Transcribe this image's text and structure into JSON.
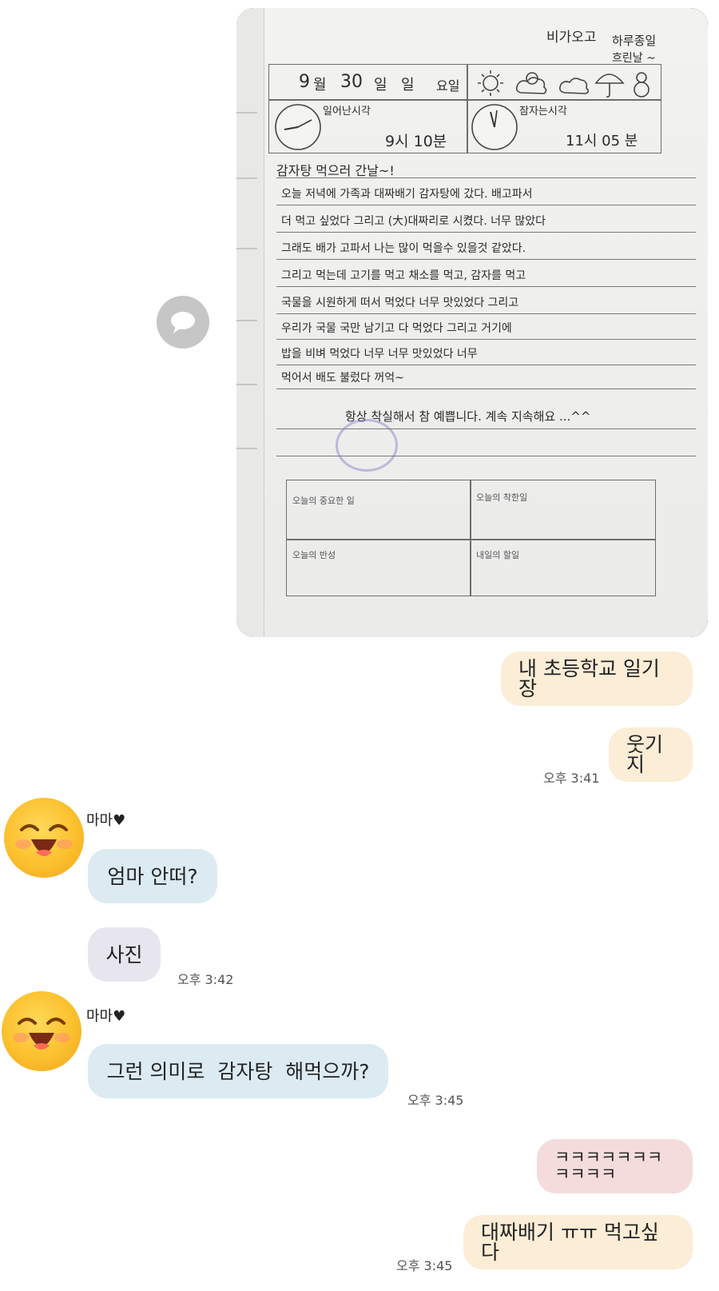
{
  "photo": {
    "top_scribble_left": "비가오고",
    "top_scribble_right": "하루종일",
    "top_scribble_right2": "흐린날 ~",
    "date": {
      "month": "9",
      "month_unit": "월",
      "day": "30",
      "day_unit": "일",
      "day2": "일",
      "weekday_unit": "요일"
    },
    "wakeup_label": "일어난시각",
    "wakeup_time": "9시 10분",
    "sleep_label": "잠자는시각",
    "sleep_time": "11시 05 분",
    "title_line": "감자탕 먹으러 간날~!",
    "lines": [
      "오늘 저녁에 가족과 대짜배기 감자탕에 갔다. 배고파서",
      "더 먹고 싶었다 그리고 (大)대짜리로 시켰다. 너무 많았다",
      "그래도 배가 고파서 나는 많이 먹을수 있을것 같았다.",
      "그리고 먹는데 고기를 먹고 채소를 먹고, 감자를 먹고",
      "국물을 시원하게 떠서 먹었다 너무 맛있었다 그리고",
      "우리가 국물 국만 남기고 다 먹었다 그리고 거기에",
      "밥을 비벼 먹었다 너무 너무 맛있었다 너무",
      "먹어서 배도 불렀다 꺼억~"
    ],
    "teacher_comment": "항상 착실해서 참 예쁩니다. 계속 지속해요 ...^^",
    "box_labels": [
      "오늘의 중요한 일",
      "오늘의 착한일",
      "오늘의 반성",
      "내일의 할일"
    ]
  },
  "messages": {
    "me1": "내 초등학교 일기장",
    "me2": "웃기지",
    "time1": "오후 3:41",
    "sender1": "마마♥",
    "them1": "엄마 안떠?",
    "them2": "사진",
    "time2": "오후 3:42",
    "sender2": "마마♥",
    "them3": "그런 의미로  감자탕  해먹으까?",
    "time3": "오후 3:45",
    "me3": "ㅋㅋㅋㅋㅋㅋㅋㅋㅋㅋㅋ",
    "me4": "대짜배기 ㅠㅠ 먹고싶다",
    "time4": "오후 3:45"
  },
  "icons": {
    "share": "speech-bubble-icon",
    "avatar": "smiling-emoji-avatar",
    "weather": [
      "sun-icon",
      "partly-cloudy-icon",
      "cloud-icon",
      "umbrella-icon",
      "snowman-icon"
    ]
  },
  "colors": {
    "my_bubble": "#fbedd6",
    "my_pink_bubble": "#f5dcdc",
    "their_bubble": "#dcebf2",
    "their_grey_bubble": "#e7e5ee"
  }
}
